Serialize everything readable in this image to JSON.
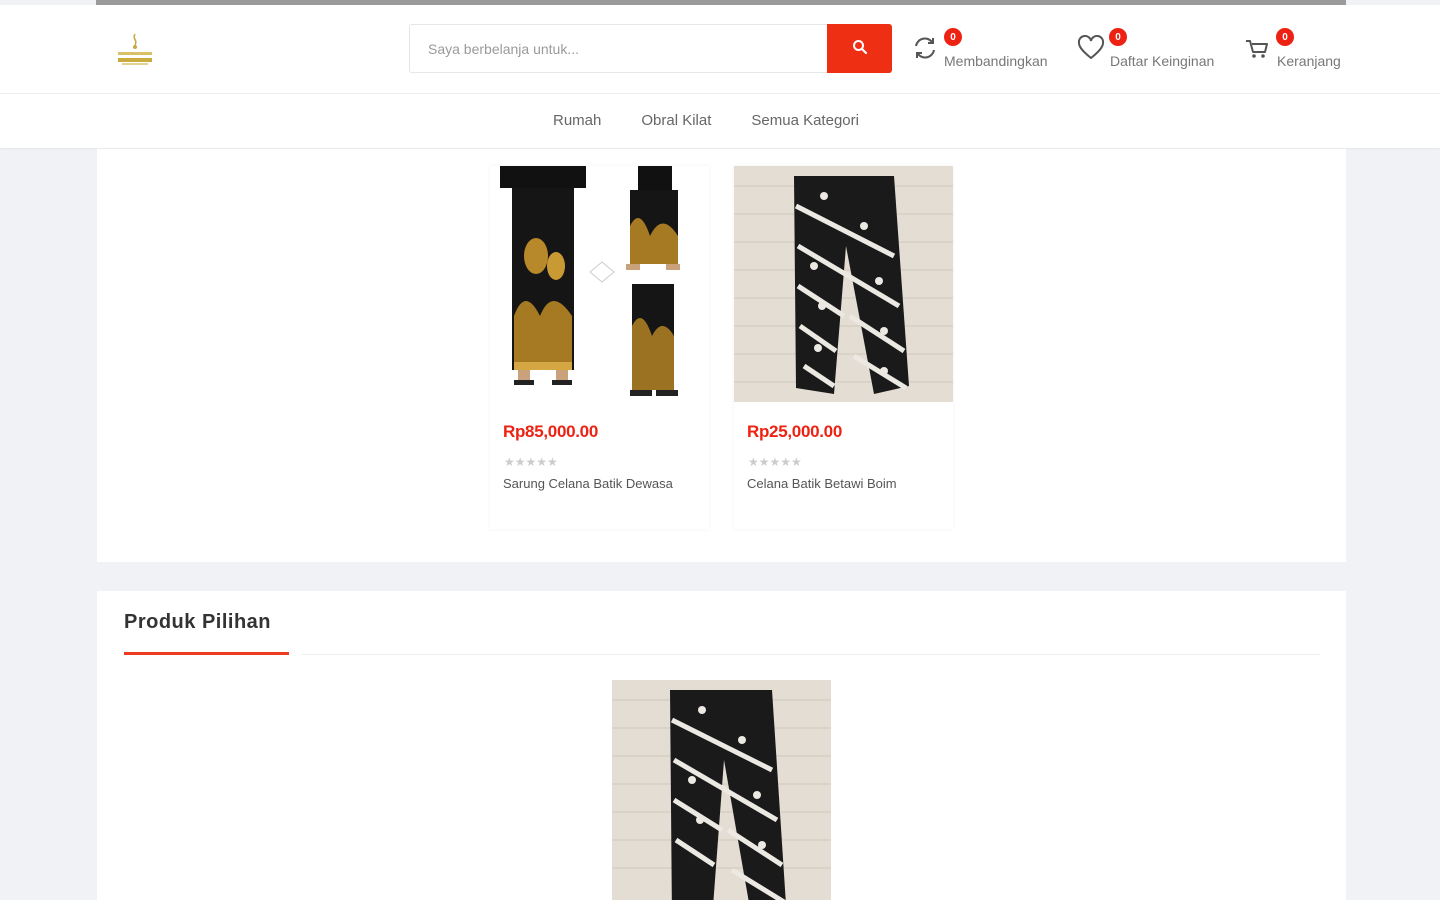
{
  "search": {
    "placeholder": "Saya berbelanja untuk..."
  },
  "header_actions": [
    {
      "label": "Membandingkan",
      "count": "0",
      "icon": "refresh-icon"
    },
    {
      "label": "Daftar Keinginan",
      "count": "0",
      "icon": "heart-icon"
    },
    {
      "label": "Keranjang",
      "count": "0",
      "icon": "cart-icon"
    }
  ],
  "nav": {
    "items": [
      "Rumah",
      "Obral Kilat",
      "Semua Kategori"
    ]
  },
  "products": [
    {
      "price": "Rp85,000.00",
      "name": "Sarung Celana Batik Dewasa",
      "rating": 0
    },
    {
      "price": "Rp25,000.00",
      "name": "Celana Batik Betawi Boim",
      "rating": 0
    }
  ],
  "featured": {
    "title": "Produk Pilihan"
  },
  "colors": {
    "accent": "#ee2f13",
    "badge": "#ee2213",
    "price": "#ee2213"
  }
}
